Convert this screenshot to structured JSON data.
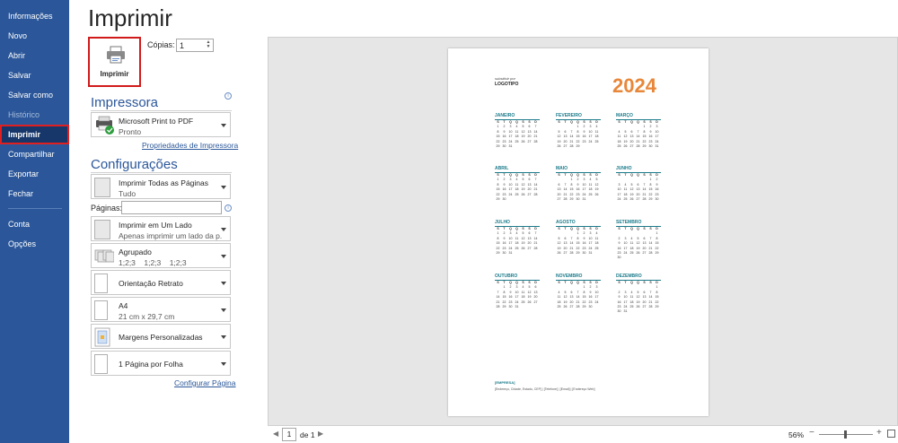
{
  "nav": {
    "items": [
      {
        "label": "Informações",
        "state": "normal"
      },
      {
        "label": "Novo",
        "state": "normal"
      },
      {
        "label": "Abrir",
        "state": "normal"
      },
      {
        "label": "Salvar",
        "state": "normal"
      },
      {
        "label": "Salvar como",
        "state": "normal"
      },
      {
        "label": "Histórico",
        "state": "disabled"
      },
      {
        "label": "Imprimir",
        "state": "active"
      },
      {
        "label": "Compartilhar",
        "state": "normal"
      },
      {
        "label": "Exportar",
        "state": "normal"
      },
      {
        "label": "Fechar",
        "state": "normal"
      },
      {
        "label": "Conta",
        "state": "normal"
      },
      {
        "label": "Opções",
        "state": "normal"
      }
    ]
  },
  "header": {
    "title": "Imprimir"
  },
  "print_button": {
    "label": "Imprimir"
  },
  "copies": {
    "label": "Cópias:",
    "value": "1"
  },
  "printer": {
    "section_title": "Impressora",
    "name": "Microsoft Print to PDF",
    "status": "Pronto",
    "properties_link": "Propriedades de Impressora"
  },
  "settings": {
    "section_title": "Configurações",
    "print_what": {
      "title": "Imprimir Todas as Páginas",
      "subtitle": "Tudo"
    },
    "pages_label": "Páginas:",
    "pages_value": "",
    "sides": {
      "title": "Imprimir em Um Lado",
      "subtitle": "Apenas imprimir um lado da p..."
    },
    "collate": {
      "title": "Agrupado",
      "subtitle": "1;2;3    1;2;3    1;2;3"
    },
    "orientation": {
      "title": "Orientação Retrato"
    },
    "paper": {
      "title": "A4",
      "subtitle": "21 cm x 29,7 cm"
    },
    "margins": {
      "title": "Margens Personalizadas"
    },
    "per_sheet": {
      "title": "1 Página por Folha"
    },
    "page_setup_link": "Configurar Página"
  },
  "preview": {
    "logo_small": "substituir por",
    "logo_big": "LOGOTIPO",
    "year": "2024",
    "weekdays": [
      "S",
      "T",
      "Q",
      "Q",
      "S",
      "S",
      "D"
    ],
    "months": [
      {
        "name": "JANEIRO",
        "offset": 0,
        "days": 31
      },
      {
        "name": "FEVEREIRO",
        "offset": 3,
        "days": 29
      },
      {
        "name": "MARÇO",
        "offset": 4,
        "days": 31
      },
      {
        "name": "ABRIL",
        "offset": 0,
        "days": 30
      },
      {
        "name": "MAIO",
        "offset": 2,
        "days": 31
      },
      {
        "name": "JUNHO",
        "offset": 5,
        "days": 30
      },
      {
        "name": "JULHO",
        "offset": 0,
        "days": 31
      },
      {
        "name": "AGOSTO",
        "offset": 3,
        "days": 31
      },
      {
        "name": "SETEMBRO",
        "offset": 6,
        "days": 30
      },
      {
        "name": "OUTUBRO",
        "offset": 1,
        "days": 31
      },
      {
        "name": "NOVEMBRO",
        "offset": 4,
        "days": 30
      },
      {
        "name": "DEZEMBRO",
        "offset": 6,
        "days": 31
      }
    ],
    "company": "[EMPRESA]",
    "contact": "[Endereço, Cidade, Estado, CEP] | [Telefone] | [Email] | [Endereço Web]"
  },
  "footer": {
    "page_current": "1",
    "page_of": "de 1",
    "zoom": "56%"
  },
  "colors": {
    "nav_bg": "#2b579a",
    "year": "#e8873a",
    "month_header": "#1a7a8a",
    "highlight": "#d11a1a"
  }
}
